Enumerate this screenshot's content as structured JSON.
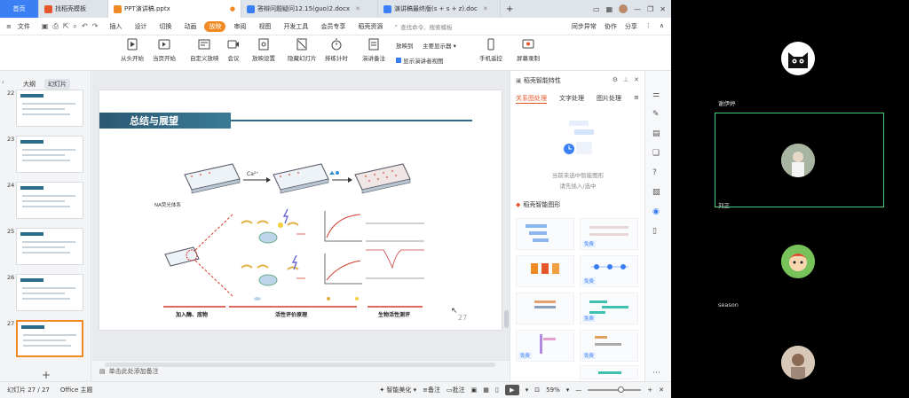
{
  "tabs": [
    {
      "label": "首页",
      "kind": "home"
    },
    {
      "label": "找稻壳模板",
      "color": "#e5572b"
    },
    {
      "label": "PPT演讲稿.pptx",
      "color": "#f08a24",
      "active": true
    },
    {
      "label": "答辩问题疑问12.15(guo)2.docx",
      "color": "#3b7ff5"
    },
    {
      "label": "演讲稿最终版(s + s + z).doc",
      "color": "#3b7ff5"
    }
  ],
  "menu": {
    "file": "文件",
    "items": [
      "插入",
      "设计",
      "切换",
      "动画",
      "放映",
      "审阅",
      "视图",
      "开发工具",
      "会员专享",
      "稻壳资源"
    ],
    "active_index": 4,
    "search_placeholder": "查找命令、搜索模板",
    "right": [
      "同步异常",
      "协作",
      "分享"
    ]
  },
  "ribbon": {
    "buttons": [
      "从头开始",
      "当页开始",
      "自定义放映",
      "会议",
      "放映设置",
      "隐藏幻灯片",
      "排练计时",
      "演讲备注",
      "手机遥控",
      "屏幕录制"
    ],
    "options": {
      "play_to": "放映到",
      "monitor": "主要显示器",
      "presenter_view": "显示演讲者视图"
    }
  },
  "sidebar": {
    "tabs": [
      "大纲",
      "幻灯片"
    ],
    "active_tab": 1,
    "slides": [
      22,
      23,
      24,
      25,
      26,
      27
    ],
    "selected": 27
  },
  "slide": {
    "title": "总结与展望",
    "ca_label": "Ca²⁺",
    "system_label": "NA荧光体系",
    "captions": [
      "加入酶、底物",
      "活性评价原理",
      "生物活性测评"
    ],
    "number": "27"
  },
  "notes_hint": "单击此处添加备注",
  "right_panel": {
    "title": "稻壳智能特性",
    "tabs": [
      "关系图处理",
      "文字处理",
      "图片处理"
    ],
    "empty_line1": "当前未选中智能图形",
    "empty_line2": "请先插入/选中",
    "section": "稻壳智能图形",
    "free_tag": "免费"
  },
  "status": {
    "slide_count": "幻灯片 27 / 27",
    "theme": "Office 主题",
    "beautify": "智能美化",
    "notes": "备注",
    "comments": "批注",
    "zoom": "59%"
  },
  "video": {
    "participants": [
      "谢伊婷",
      "刘正",
      "season",
      ""
    ]
  },
  "colors": {
    "accent": "#f08a24",
    "brand_blue": "#3b7ff5",
    "active_speaker": "#3fd07a"
  }
}
